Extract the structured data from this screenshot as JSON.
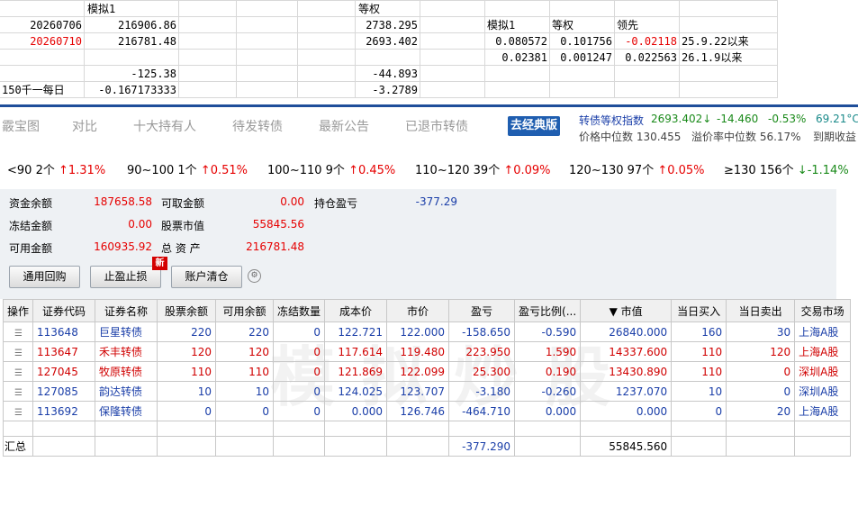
{
  "sheet": {
    "header_a": "模拟1",
    "header_b": "等权",
    "rows": [
      {
        "date": "20260706",
        "value": "216906.86",
        "eq": "2738.295"
      },
      {
        "date": "20260710",
        "value": "216781.48",
        "eq": "2693.402"
      }
    ],
    "diff_value": "-125.38",
    "diff_eq": "-44.893",
    "daily_label": "150千一每日",
    "daily_value": "-0.167173333",
    "daily_eq": "-3.2789",
    "side_headers": [
      "模拟1",
      "等权",
      "领先"
    ],
    "side_rows": [
      {
        "a": "0.080572",
        "b": "0.101756",
        "c": "-0.02118",
        "note": "25.9.22以来"
      },
      {
        "a": "0.02381",
        "b": "0.001247",
        "c": "0.022563",
        "note": "26.1.9以来"
      }
    ]
  },
  "nav": {
    "items": [
      "霰宝图",
      "对比",
      "十大持有人",
      "待发转债",
      "最新公告",
      "已退市转债"
    ],
    "classic_button": "去经典版",
    "index_label": "转债等权指数",
    "index_value": "2693.402↓",
    "index_change": "-14.460",
    "index_pct": "-0.53%",
    "index_temp": "69.21°C",
    "median_price": "价格中位数 130.455",
    "median_premium": "溢价率中位数 56.17%",
    "ytm_label": "到期收益"
  },
  "buckets": [
    {
      "range": "<90 2个",
      "chg": "↑1.31%",
      "dir": "up"
    },
    {
      "range": "90~100 1个",
      "chg": "↑0.51%",
      "dir": "up"
    },
    {
      "range": "100~110 9个",
      "chg": "↑0.45%",
      "dir": "up"
    },
    {
      "range": "110~120 39个",
      "chg": "↑0.09%",
      "dir": "up"
    },
    {
      "range": "120~130 97个",
      "chg": "↑0.05%",
      "dir": "up"
    },
    {
      "range": "≥130 156个",
      "chg": "↓-1.14%",
      "dir": "down"
    }
  ],
  "account": {
    "cash_balance_label": "资金余额",
    "cash_balance": "187658.58",
    "withdrawable_label": "可取金额",
    "withdrawable": "0.00",
    "pnl_label": "持仓盈亏",
    "pnl": "-377.29",
    "frozen_label": "冻结金额",
    "frozen": "0.00",
    "stock_value_label": "股票市值",
    "stock_value": "55845.56",
    "available_label": "可用金额",
    "available": "160935.92",
    "total_assets_label": "总 资 产",
    "total_assets": "216781.48",
    "btn_repo": "通用回购",
    "btn_stop": "止盈止损",
    "new_badge": "新",
    "btn_clear": "账户清仓"
  },
  "table": {
    "headers": [
      "操作",
      "证券代码",
      "证券名称",
      "股票余额",
      "可用余额",
      "冻结数量",
      "成本价",
      "市价",
      "盈亏",
      "盈亏比例(...",
      "▼ 市值",
      "当日买入",
      "当日卖出",
      "交易市场"
    ],
    "rows": [
      [
        "113648",
        "巨星转债",
        "220",
        "220",
        "0",
        "122.721",
        "122.000",
        "-158.650",
        "-0.590",
        "26840.000",
        "160",
        "30",
        "上海A股"
      ],
      [
        "113647",
        "禾丰转债",
        "120",
        "120",
        "0",
        "117.614",
        "119.480",
        "223.950",
        "1.590",
        "14337.600",
        "110",
        "120",
        "上海A股"
      ],
      [
        "127045",
        "牧原转债",
        "110",
        "110",
        "0",
        "121.869",
        "122.099",
        "25.300",
        "0.190",
        "13430.890",
        "110",
        "0",
        "深圳A股"
      ],
      [
        "127085",
        "韵达转债",
        "10",
        "10",
        "0",
        "124.025",
        "123.707",
        "-3.180",
        "-0.260",
        "1237.070",
        "10",
        "0",
        "深圳A股"
      ],
      [
        "113692",
        "保隆转债",
        "0",
        "0",
        "0",
        "0.000",
        "126.746",
        "-464.710",
        "0.000",
        "0.000",
        "0",
        "20",
        "上海A股"
      ]
    ],
    "row_colors": [
      "blue",
      "red",
      "red",
      "blue",
      "blue"
    ],
    "total_label": "汇总",
    "total_pnl": "-377.290",
    "total_value": "55845.560"
  },
  "watermark": "模拟炒股"
}
